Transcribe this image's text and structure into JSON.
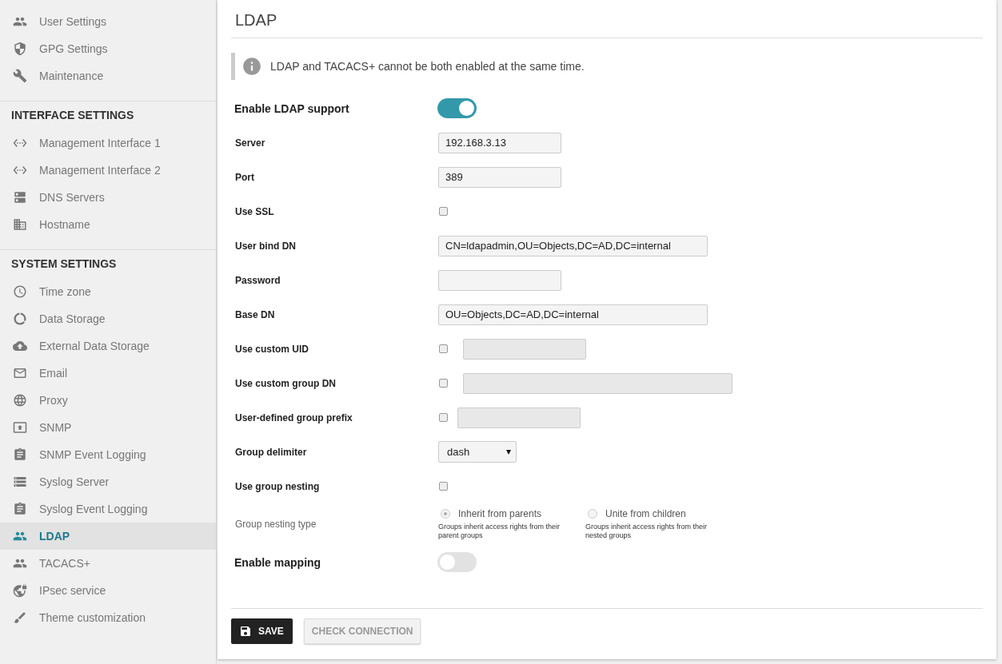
{
  "sidebar": {
    "sections": [
      {
        "items": [
          {
            "label": "User Settings",
            "selected": false
          },
          {
            "label": "GPG Settings",
            "selected": false
          },
          {
            "label": "Maintenance",
            "selected": false
          }
        ]
      },
      {
        "heading": "INTERFACE SETTINGS",
        "items": [
          {
            "label": "Management Interface 1",
            "selected": false
          },
          {
            "label": "Management Interface 2",
            "selected": false
          },
          {
            "label": "DNS Servers",
            "selected": false
          },
          {
            "label": "Hostname",
            "selected": false
          }
        ]
      },
      {
        "heading": "SYSTEM SETTINGS",
        "items": [
          {
            "label": "Time zone",
            "selected": false
          },
          {
            "label": "Data Storage",
            "selected": false
          },
          {
            "label": "External Data Storage",
            "selected": false
          },
          {
            "label": "Email",
            "selected": false
          },
          {
            "label": "Proxy",
            "selected": false
          },
          {
            "label": "SNMP",
            "selected": false
          },
          {
            "label": "SNMP Event Logging",
            "selected": false
          },
          {
            "label": "Syslog Server",
            "selected": false
          },
          {
            "label": "Syslog Event Logging",
            "selected": false
          },
          {
            "label": "LDAP",
            "selected": true
          },
          {
            "label": "TACACS+",
            "selected": false
          },
          {
            "label": "IPsec service",
            "selected": false
          },
          {
            "label": "Theme customization",
            "selected": false
          }
        ]
      }
    ]
  },
  "page": {
    "title": "LDAP",
    "notice": "LDAP and TACACS+ cannot be both enabled at the same time."
  },
  "form": [
    {
      "kind": "toggle",
      "label": "Enable LDAP support",
      "on": true
    },
    {
      "kind": "text",
      "label": "Server",
      "value": "192.168.3.13",
      "wide": false
    },
    {
      "kind": "text",
      "label": "Port",
      "value": "389",
      "wide": false
    },
    {
      "kind": "checkbox",
      "label": "Use SSL",
      "checked": false
    },
    {
      "kind": "text",
      "label": "User bind DN",
      "value": "CN=ldapadmin,OU=Objects,DC=AD,DC=internal",
      "wide": true
    },
    {
      "kind": "text",
      "label": "Password",
      "wide": false
    },
    {
      "kind": "text",
      "label": "Base DN",
      "value": "OU=Objects,DC=AD,DC=internal",
      "wide": true
    },
    {
      "kind": "check_text",
      "label": "Use custom UID",
      "checked": false,
      "disabled": true,
      "wide": false
    },
    {
      "kind": "check_text",
      "label": "Use custom group DN",
      "checked": false,
      "disabled": true,
      "wide": true
    },
    {
      "kind": "check_text",
      "label": "User-defined group prefix",
      "checked": false,
      "disabled": true,
      "wide": false
    },
    {
      "kind": "select",
      "label": "Group delimiter",
      "value": "dash"
    },
    {
      "kind": "checkbox",
      "label": "Use group nesting",
      "checked": false
    },
    {
      "kind": "radio",
      "label": "Group nesting type",
      "disabled": true,
      "options": [
        {
          "label": "Inherit from parents",
          "hint": "Groups inherit access rights from their parent groups",
          "selected": true
        },
        {
          "label": "Unite from children",
          "hint": "Groups inherit access rights from their nested groups",
          "selected": false
        }
      ]
    },
    {
      "kind": "toggle",
      "label": "Enable mapping",
      "on": false
    }
  ],
  "buttons": [
    {
      "label": "SAVE",
      "kind": "primary"
    },
    {
      "label": "CHECK CONNECTION",
      "kind": "secondary"
    }
  ]
}
